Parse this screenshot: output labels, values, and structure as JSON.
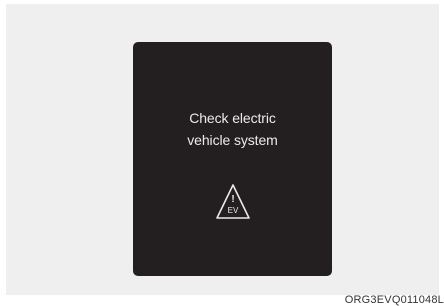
{
  "display": {
    "message_line1": "Check electric",
    "message_line2": "vehicle system",
    "icon": {
      "name": "ev-system-warning-icon",
      "exclamation": "!",
      "label": "EV"
    }
  },
  "figure_code": "ORG3EVQ011048L",
  "colors": {
    "background": "#efefef",
    "display": "#231f20",
    "display_text": "#eaeaea"
  }
}
